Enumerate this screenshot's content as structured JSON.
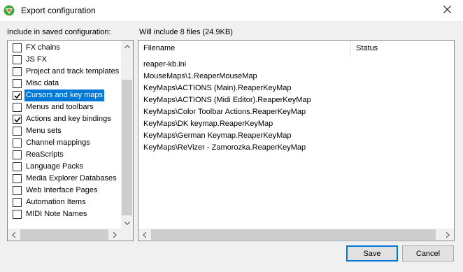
{
  "window": {
    "title": "Export configuration",
    "close_glyph": "✕"
  },
  "left": {
    "heading": "Include in saved configuration:",
    "items": [
      {
        "label": "FX chains",
        "checked": false,
        "selected": false
      },
      {
        "label": "JS FX",
        "checked": false,
        "selected": false
      },
      {
        "label": "Project and track templates",
        "checked": false,
        "selected": false
      },
      {
        "label": "Misc data",
        "checked": false,
        "selected": false
      },
      {
        "label": "Cursors and key maps",
        "checked": true,
        "selected": true
      },
      {
        "label": "Menus and toolbars",
        "checked": false,
        "selected": false
      },
      {
        "label": "Actions and key bindings",
        "checked": true,
        "selected": false
      },
      {
        "label": "Menu sets",
        "checked": false,
        "selected": false
      },
      {
        "label": "Channel mappings",
        "checked": false,
        "selected": false
      },
      {
        "label": "ReaScripts",
        "checked": false,
        "selected": false
      },
      {
        "label": "Language Packs",
        "checked": false,
        "selected": false
      },
      {
        "label": "Media Explorer Databases",
        "checked": false,
        "selected": false
      },
      {
        "label": "Web Interface Pages",
        "checked": false,
        "selected": false
      },
      {
        "label": "Automation Items",
        "checked": false,
        "selected": false
      },
      {
        "label": "MIDI Note Names",
        "checked": false,
        "selected": false
      }
    ]
  },
  "right": {
    "summary": "Will include 8 files (24.9KB)",
    "columns": [
      "Filename",
      "Status"
    ],
    "files": [
      "reaper-kb.ini",
      "MouseMaps\\1.ReaperMouseMap",
      "KeyMaps\\ACTIONS (Main).ReaperKeyMap",
      "KeyMaps\\ACTIONS (Midi Editor).ReaperKeyMap",
      "KeyMaps\\Color Toolbar Actions.ReaperKeyMap",
      "KeyMaps\\DK keymap.ReaperKeyMap",
      "KeyMaps\\German Keymap.ReaperKeyMap",
      "KeyMaps\\ReVizer - Zamorozka.ReaperKeyMap"
    ]
  },
  "buttons": {
    "save": "Save",
    "cancel": "Cancel"
  },
  "colors": {
    "selection": "#0078d7",
    "app_icon_green": "#3da844",
    "app_icon_orange": "#e8741e"
  },
  "icons": [
    "reaper-app-icon",
    "close-icon",
    "checkbox-check-icon",
    "scroll-up-arrow-icon",
    "scroll-down-arrow-icon",
    "scroll-left-arrow-icon",
    "scroll-right-arrow-icon"
  ]
}
